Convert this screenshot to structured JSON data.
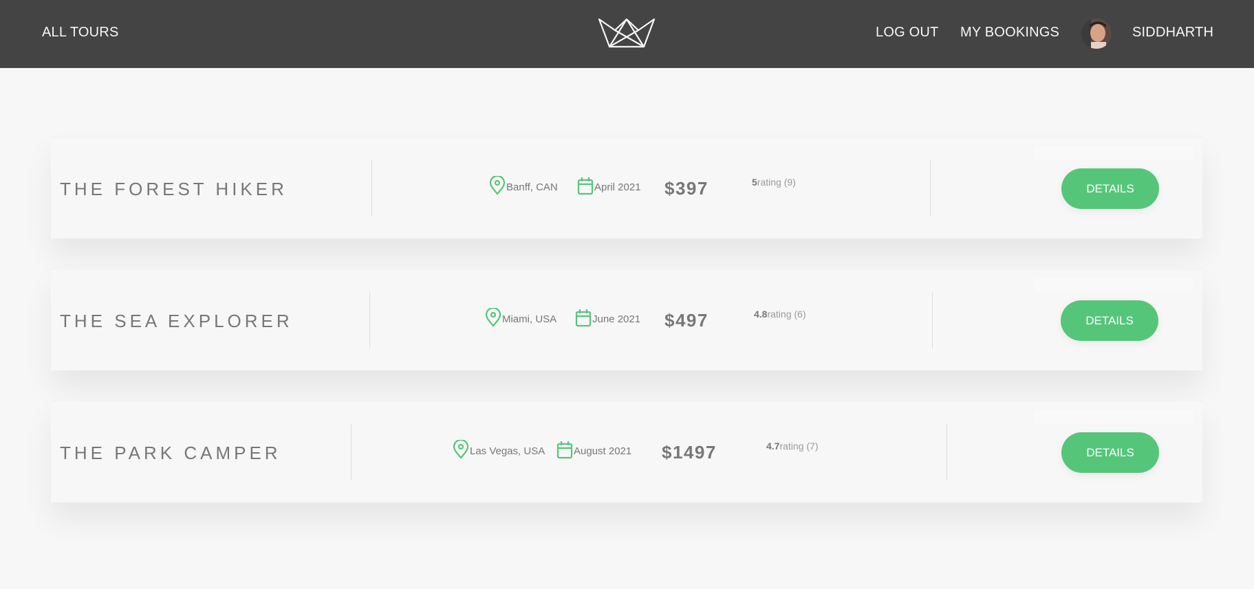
{
  "header": {
    "all_tours": "ALL TOURS",
    "log_out": "LOG OUT",
    "my_bookings": "MY BOOKINGS",
    "user_name": "SIDDHARTH"
  },
  "colors": {
    "header_bg": "#444444",
    "accent": "#55c57a",
    "page_bg": "#f7f7f7",
    "text": "#777777"
  },
  "icons": {
    "location": "map-pin-icon",
    "date": "calendar-icon",
    "logo": "crown-logo-icon"
  },
  "tours": [
    {
      "name": "THE FOREST HIKER",
      "location": "Banff, CAN",
      "date": "April 2021",
      "price": "$397",
      "rating_value": "5",
      "rating_label": "rating (9)",
      "button": "DETAILS"
    },
    {
      "name": "THE SEA EXPLORER",
      "location": "Miami, USA",
      "date": "June 2021",
      "price": "$497",
      "rating_value": "4.8",
      "rating_label": "rating (6)",
      "button": "DETAILS"
    },
    {
      "name": "THE PARK CAMPER",
      "location": "Las Vegas, USA",
      "date": "August 2021",
      "price": "$1497",
      "rating_value": "4.7",
      "rating_label": "rating (7)",
      "button": "DETAILS"
    }
  ]
}
